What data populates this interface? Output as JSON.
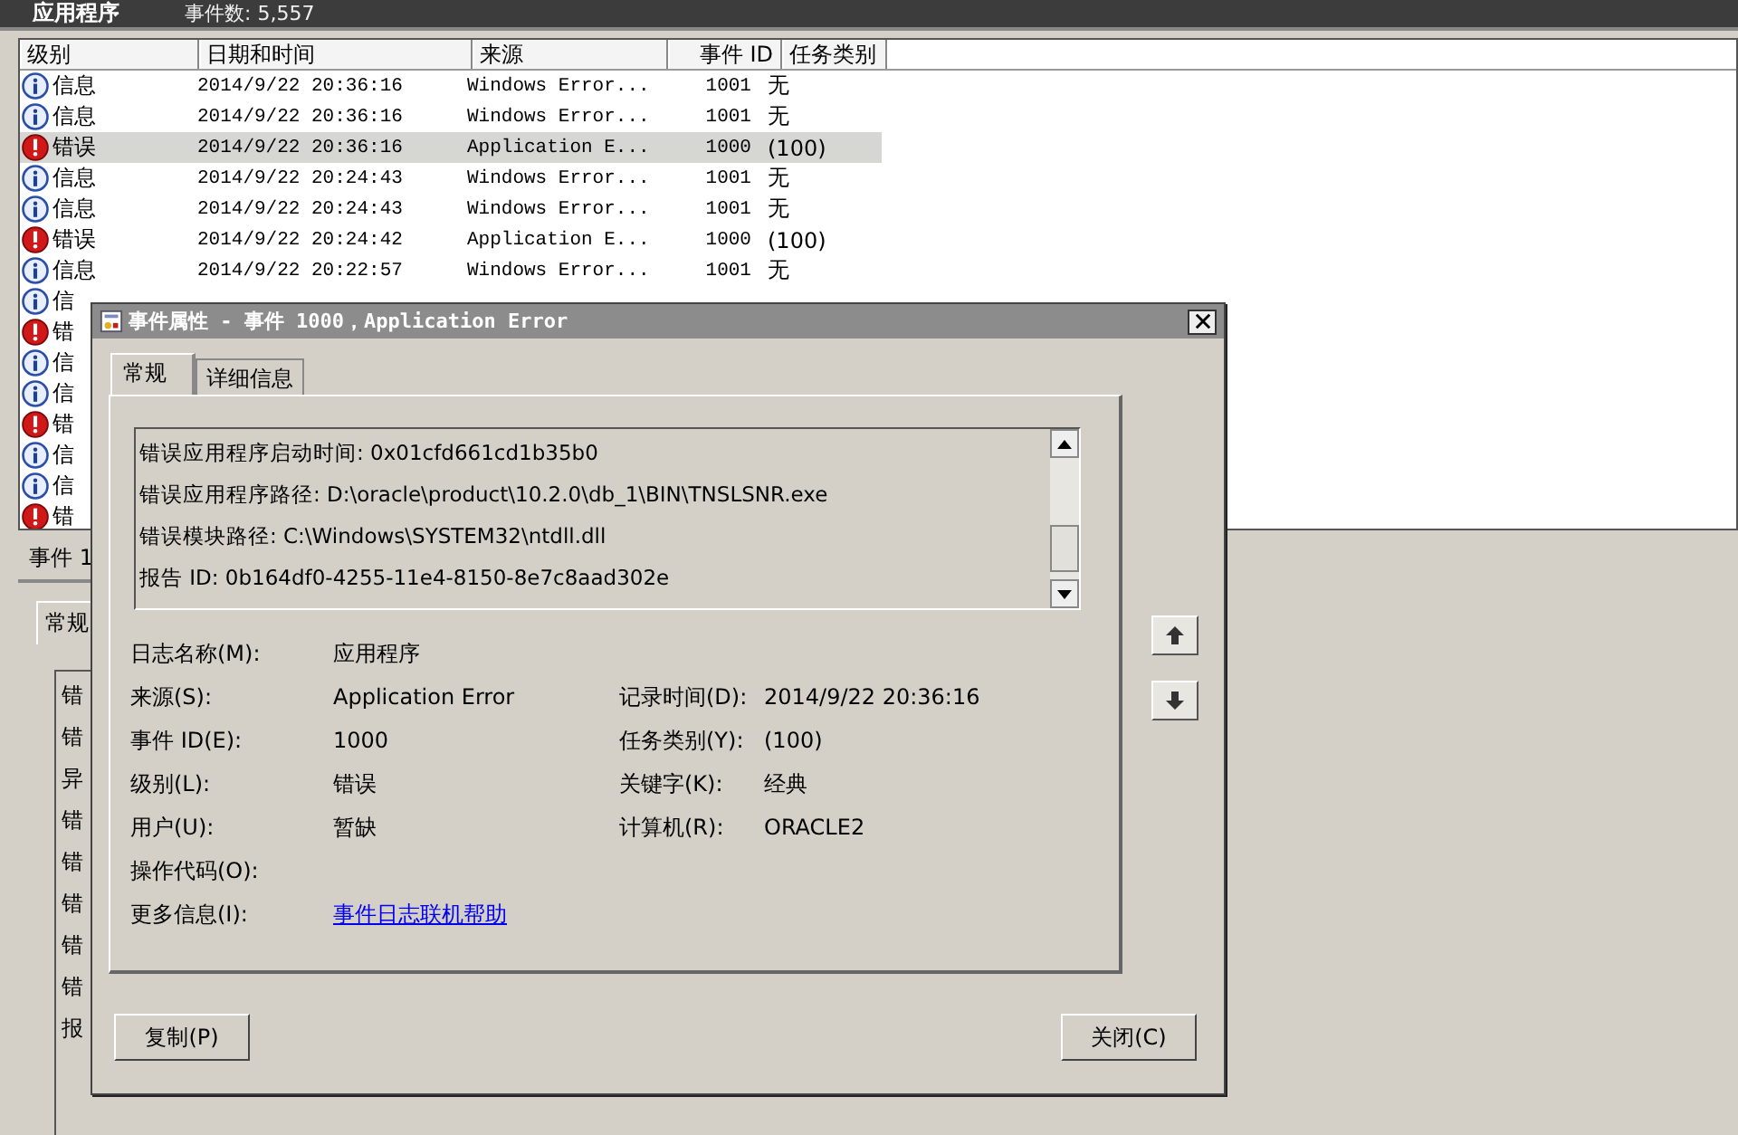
{
  "header": {
    "title": "应用程序",
    "count": "事件数: 5,557"
  },
  "columns": [
    "级别",
    "日期和时间",
    "来源",
    "事件 ID",
    "任务类别"
  ],
  "rows": [
    {
      "kind": "info",
      "level_text": "信息",
      "date": "2014/9/22 20:36:16",
      "source": "Windows Error...",
      "id": "1001",
      "task": "无",
      "selected": false
    },
    {
      "kind": "info",
      "level_text": "信息",
      "date": "2014/9/22 20:36:16",
      "source": "Windows Error...",
      "id": "1001",
      "task": "无",
      "selected": false
    },
    {
      "kind": "error",
      "level_text": "错误",
      "date": "2014/9/22 20:36:16",
      "source": "Application E...",
      "id": "1000",
      "task": "(100)",
      "selected": true
    },
    {
      "kind": "info",
      "level_text": "信息",
      "date": "2014/9/22 20:24:43",
      "source": "Windows Error...",
      "id": "1001",
      "task": "无",
      "selected": false
    },
    {
      "kind": "info",
      "level_text": "信息",
      "date": "2014/9/22 20:24:43",
      "source": "Windows Error...",
      "id": "1001",
      "task": "无",
      "selected": false
    },
    {
      "kind": "error",
      "level_text": "错误",
      "date": "2014/9/22 20:24:42",
      "source": "Application E...",
      "id": "1000",
      "task": "(100)",
      "selected": false
    },
    {
      "kind": "info",
      "level_text": "信息",
      "date": "2014/9/22 20:22:57",
      "source": "Windows Error...",
      "id": "1001",
      "task": "无",
      "selected": false
    },
    {
      "kind": "info",
      "level_text": "信",
      "selected": false
    },
    {
      "kind": "error",
      "level_text": "错",
      "selected": false
    },
    {
      "kind": "info",
      "level_text": "信",
      "selected": false
    },
    {
      "kind": "info",
      "level_text": "信",
      "selected": false
    },
    {
      "kind": "error",
      "level_text": "错",
      "selected": false
    },
    {
      "kind": "info",
      "level_text": "信",
      "selected": false
    },
    {
      "kind": "info",
      "level_text": "信",
      "selected": false
    },
    {
      "kind": "error",
      "level_text": "错",
      "selected": false
    }
  ],
  "detail_pane": {
    "tab": "事件 1",
    "subtab": "常规",
    "lines": [
      "错",
      "错",
      "异",
      "错",
      "错",
      "错",
      "错",
      "错",
      "报"
    ]
  },
  "dialog": {
    "title": "事件属性 - 事件 1000，Application Error",
    "tabs": [
      {
        "label": "常规",
        "selected": true
      },
      {
        "label": "详细信息",
        "selected": false
      }
    ],
    "description": [
      "错误应用程序启动时间: 0x01cfd661cd1b35b0",
      "错误应用程序路径: D:\\oracle\\product\\10.2.0\\db_1\\BIN\\TNSLSNR.exe",
      "错误模块路径: C:\\Windows\\SYSTEM32\\ntdll.dll",
      "报告 ID: 0b164df0-4255-11e4-8150-8e7c8aad302e"
    ],
    "fields": [
      {
        "left": {
          "label": "日志名称(M):",
          "value": "应用程序"
        }
      },
      {
        "left": {
          "label": "来源(S):",
          "value": "Application Error"
        },
        "right": {
          "label": "记录时间(D):",
          "value": "2014/9/22 20:36:16"
        }
      },
      {
        "left": {
          "label": "事件 ID(E):",
          "value": "1000"
        },
        "right": {
          "label": "任务类别(Y):",
          "value": "(100)"
        }
      },
      {
        "left": {
          "label": "级别(L):",
          "value": "错误"
        },
        "right": {
          "label": "关键字(K):",
          "value": "经典"
        }
      },
      {
        "left": {
          "label": "用户(U):",
          "value": "暂缺"
        },
        "right": {
          "label": "计算机(R):",
          "value": "ORACLE2"
        }
      },
      {
        "left": {
          "label": "操作代码(O):"
        }
      },
      {
        "left": {
          "label": "更多信息(I):",
          "link": "事件日志联机帮助"
        }
      }
    ],
    "buttons": {
      "copy": "复制(P)",
      "close": "关闭(C)"
    }
  }
}
